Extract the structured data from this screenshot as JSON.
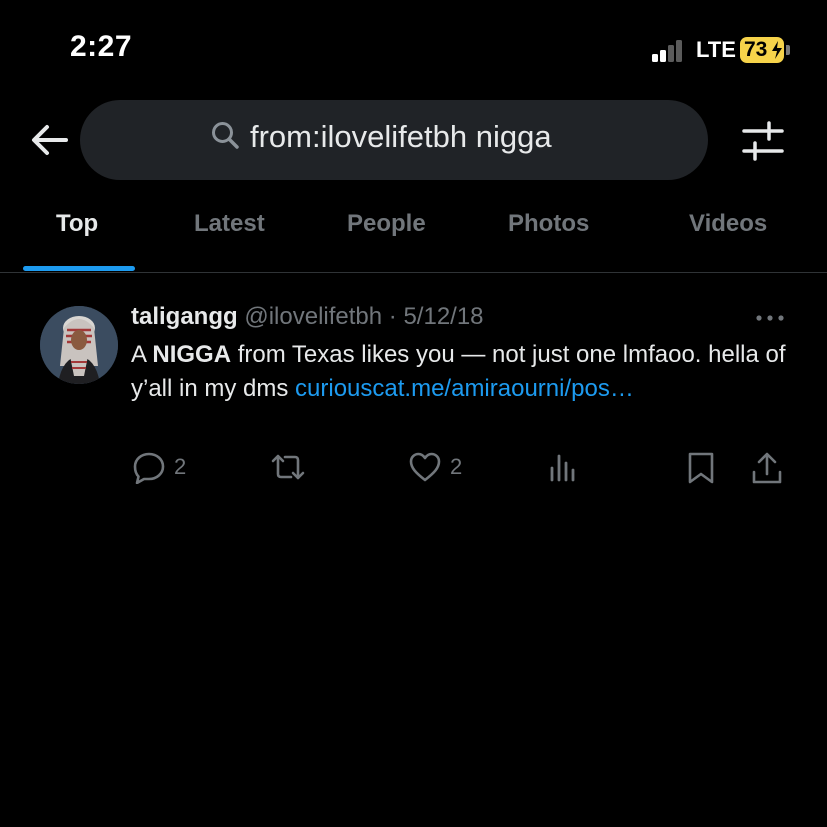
{
  "status_bar": {
    "time": "2:27",
    "network": "LTE",
    "battery": "73"
  },
  "search": {
    "query": "from:ilovelifetbh nigga"
  },
  "tabs": [
    {
      "label": "Top",
      "active": true
    },
    {
      "label": "Latest",
      "active": false
    },
    {
      "label": "People",
      "active": false
    },
    {
      "label": "Photos",
      "active": false
    },
    {
      "label": "Videos",
      "active": false
    }
  ],
  "tweet": {
    "display_name": "taligangg",
    "handle": "@ilovelifetbh",
    "separator": "·",
    "date": "5/12/18",
    "text_start": "A ",
    "text_bold": "NIGGA",
    "text_rest": " from Texas likes you — not just one lmfaoo. hella of y’all in my dms ",
    "link": "curiouscat.me/amiraourni/pos…",
    "replies": "2",
    "likes": "2"
  },
  "colors": {
    "accent": "#1d9bf0",
    "background": "#000000",
    "secondary_text": "#71767b",
    "battery": "#f6d34a"
  }
}
